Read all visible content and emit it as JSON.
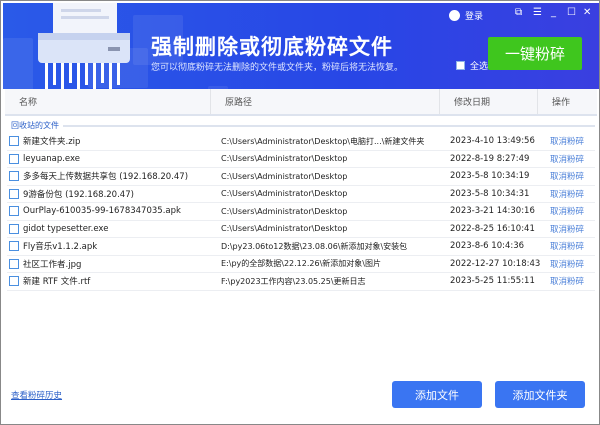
{
  "header": {
    "title": "强制删除或彻底粉碎文件",
    "subtitle": "您可以彻底粉碎无法删除的文件或文件夹，粉碎后将无法恢复。",
    "login": "登录",
    "select_all": "全选",
    "shred_button": "一键粉碎"
  },
  "table": {
    "columns": [
      "名称",
      "原路径",
      "修改日期",
      "操作"
    ],
    "section": "回收站的文件",
    "rows": [
      {
        "name": "新建文件夹.zip",
        "path": "C:\\Users\\Administrator\\Desktop\\电脑打...\\新建文件夹",
        "date": "2023-4-10 13:49:56",
        "action": "取消粉碎"
      },
      {
        "name": "leyuanap.exe",
        "path": "C:\\Users\\Administrator\\Desktop",
        "date": "2022-8-19 8:27:49",
        "action": "取消粉碎"
      },
      {
        "name": "多多每天上传数据共享包 (192.168.20.47)",
        "path": "C:\\Users\\Administrator\\Desktop",
        "date": "2023-5-8 10:34:19",
        "action": "取消粉碎"
      },
      {
        "name": "9游备份包 (192.168.20.47)",
        "path": "C:\\Users\\Administrator\\Desktop",
        "date": "2023-5-8 10:34:31",
        "action": "取消粉碎"
      },
      {
        "name": "OurPlay-610035-99-1678347035.apk",
        "path": "C:\\Users\\Administrator\\Desktop",
        "date": "2023-3-21 14:30:16",
        "action": "取消粉碎"
      },
      {
        "name": "gidot typesetter.exe",
        "path": "C:\\Users\\Administrator\\Desktop",
        "date": "2022-8-25 16:10:41",
        "action": "取消粉碎"
      },
      {
        "name": "Fly音乐v1.1.2.apk",
        "path": "D:\\py23.06to12数据\\23.08.06\\新添加对象\\安装包",
        "date": "2023-8-6 10:4:36",
        "action": "取消粉碎"
      },
      {
        "name": "社区工作者.jpg",
        "path": "E:\\py的全部数据\\22.12.26\\新添加对象\\图片",
        "date": "2022-12-27 10:18:43",
        "action": "取消粉碎"
      },
      {
        "name": "新建 RTF 文件.rtf",
        "path": "F:\\py2023工作内容\\23.05.25\\更新日志",
        "date": "2023-5-25 11:55:11",
        "action": "取消粉碎"
      }
    ]
  },
  "footer": {
    "history": "查看粉碎历史",
    "add_file": "添加文件",
    "add_folder": "添加文件夹"
  }
}
